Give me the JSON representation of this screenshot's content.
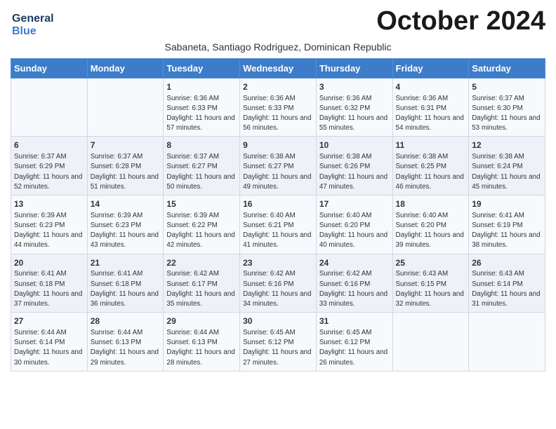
{
  "header": {
    "logo_line1": "General",
    "logo_line2": "Blue",
    "month_title": "October 2024",
    "subtitle": "Sabaneta, Santiago Rodriguez, Dominican Republic"
  },
  "weekdays": [
    "Sunday",
    "Monday",
    "Tuesday",
    "Wednesday",
    "Thursday",
    "Friday",
    "Saturday"
  ],
  "weeks": [
    [
      {
        "day": "",
        "sunrise": "",
        "sunset": "",
        "daylight": ""
      },
      {
        "day": "",
        "sunrise": "",
        "sunset": "",
        "daylight": ""
      },
      {
        "day": "1",
        "sunrise": "Sunrise: 6:36 AM",
        "sunset": "Sunset: 6:33 PM",
        "daylight": "Daylight: 11 hours and 57 minutes."
      },
      {
        "day": "2",
        "sunrise": "Sunrise: 6:36 AM",
        "sunset": "Sunset: 6:33 PM",
        "daylight": "Daylight: 11 hours and 56 minutes."
      },
      {
        "day": "3",
        "sunrise": "Sunrise: 6:36 AM",
        "sunset": "Sunset: 6:32 PM",
        "daylight": "Daylight: 11 hours and 55 minutes."
      },
      {
        "day": "4",
        "sunrise": "Sunrise: 6:36 AM",
        "sunset": "Sunset: 6:31 PM",
        "daylight": "Daylight: 11 hours and 54 minutes."
      },
      {
        "day": "5",
        "sunrise": "Sunrise: 6:37 AM",
        "sunset": "Sunset: 6:30 PM",
        "daylight": "Daylight: 11 hours and 53 minutes."
      }
    ],
    [
      {
        "day": "6",
        "sunrise": "Sunrise: 6:37 AM",
        "sunset": "Sunset: 6:29 PM",
        "daylight": "Daylight: 11 hours and 52 minutes."
      },
      {
        "day": "7",
        "sunrise": "Sunrise: 6:37 AM",
        "sunset": "Sunset: 6:28 PM",
        "daylight": "Daylight: 11 hours and 51 minutes."
      },
      {
        "day": "8",
        "sunrise": "Sunrise: 6:37 AM",
        "sunset": "Sunset: 6:27 PM",
        "daylight": "Daylight: 11 hours and 50 minutes."
      },
      {
        "day": "9",
        "sunrise": "Sunrise: 6:38 AM",
        "sunset": "Sunset: 6:27 PM",
        "daylight": "Daylight: 11 hours and 49 minutes."
      },
      {
        "day": "10",
        "sunrise": "Sunrise: 6:38 AM",
        "sunset": "Sunset: 6:26 PM",
        "daylight": "Daylight: 11 hours and 47 minutes."
      },
      {
        "day": "11",
        "sunrise": "Sunrise: 6:38 AM",
        "sunset": "Sunset: 6:25 PM",
        "daylight": "Daylight: 11 hours and 46 minutes."
      },
      {
        "day": "12",
        "sunrise": "Sunrise: 6:38 AM",
        "sunset": "Sunset: 6:24 PM",
        "daylight": "Daylight: 11 hours and 45 minutes."
      }
    ],
    [
      {
        "day": "13",
        "sunrise": "Sunrise: 6:39 AM",
        "sunset": "Sunset: 6:23 PM",
        "daylight": "Daylight: 11 hours and 44 minutes."
      },
      {
        "day": "14",
        "sunrise": "Sunrise: 6:39 AM",
        "sunset": "Sunset: 6:23 PM",
        "daylight": "Daylight: 11 hours and 43 minutes."
      },
      {
        "day": "15",
        "sunrise": "Sunrise: 6:39 AM",
        "sunset": "Sunset: 6:22 PM",
        "daylight": "Daylight: 11 hours and 42 minutes."
      },
      {
        "day": "16",
        "sunrise": "Sunrise: 6:40 AM",
        "sunset": "Sunset: 6:21 PM",
        "daylight": "Daylight: 11 hours and 41 minutes."
      },
      {
        "day": "17",
        "sunrise": "Sunrise: 6:40 AM",
        "sunset": "Sunset: 6:20 PM",
        "daylight": "Daylight: 11 hours and 40 minutes."
      },
      {
        "day": "18",
        "sunrise": "Sunrise: 6:40 AM",
        "sunset": "Sunset: 6:20 PM",
        "daylight": "Daylight: 11 hours and 39 minutes."
      },
      {
        "day": "19",
        "sunrise": "Sunrise: 6:41 AM",
        "sunset": "Sunset: 6:19 PM",
        "daylight": "Daylight: 11 hours and 38 minutes."
      }
    ],
    [
      {
        "day": "20",
        "sunrise": "Sunrise: 6:41 AM",
        "sunset": "Sunset: 6:18 PM",
        "daylight": "Daylight: 11 hours and 37 minutes."
      },
      {
        "day": "21",
        "sunrise": "Sunrise: 6:41 AM",
        "sunset": "Sunset: 6:18 PM",
        "daylight": "Daylight: 11 hours and 36 minutes."
      },
      {
        "day": "22",
        "sunrise": "Sunrise: 6:42 AM",
        "sunset": "Sunset: 6:17 PM",
        "daylight": "Daylight: 11 hours and 35 minutes."
      },
      {
        "day": "23",
        "sunrise": "Sunrise: 6:42 AM",
        "sunset": "Sunset: 6:16 PM",
        "daylight": "Daylight: 11 hours and 34 minutes."
      },
      {
        "day": "24",
        "sunrise": "Sunrise: 6:42 AM",
        "sunset": "Sunset: 6:16 PM",
        "daylight": "Daylight: 11 hours and 33 minutes."
      },
      {
        "day": "25",
        "sunrise": "Sunrise: 6:43 AM",
        "sunset": "Sunset: 6:15 PM",
        "daylight": "Daylight: 11 hours and 32 minutes."
      },
      {
        "day": "26",
        "sunrise": "Sunrise: 6:43 AM",
        "sunset": "Sunset: 6:14 PM",
        "daylight": "Daylight: 11 hours and 31 minutes."
      }
    ],
    [
      {
        "day": "27",
        "sunrise": "Sunrise: 6:44 AM",
        "sunset": "Sunset: 6:14 PM",
        "daylight": "Daylight: 11 hours and 30 minutes."
      },
      {
        "day": "28",
        "sunrise": "Sunrise: 6:44 AM",
        "sunset": "Sunset: 6:13 PM",
        "daylight": "Daylight: 11 hours and 29 minutes."
      },
      {
        "day": "29",
        "sunrise": "Sunrise: 6:44 AM",
        "sunset": "Sunset: 6:13 PM",
        "daylight": "Daylight: 11 hours and 28 minutes."
      },
      {
        "day": "30",
        "sunrise": "Sunrise: 6:45 AM",
        "sunset": "Sunset: 6:12 PM",
        "daylight": "Daylight: 11 hours and 27 minutes."
      },
      {
        "day": "31",
        "sunrise": "Sunrise: 6:45 AM",
        "sunset": "Sunset: 6:12 PM",
        "daylight": "Daylight: 11 hours and 26 minutes."
      },
      {
        "day": "",
        "sunrise": "",
        "sunset": "",
        "daylight": ""
      },
      {
        "day": "",
        "sunrise": "",
        "sunset": "",
        "daylight": ""
      }
    ]
  ]
}
